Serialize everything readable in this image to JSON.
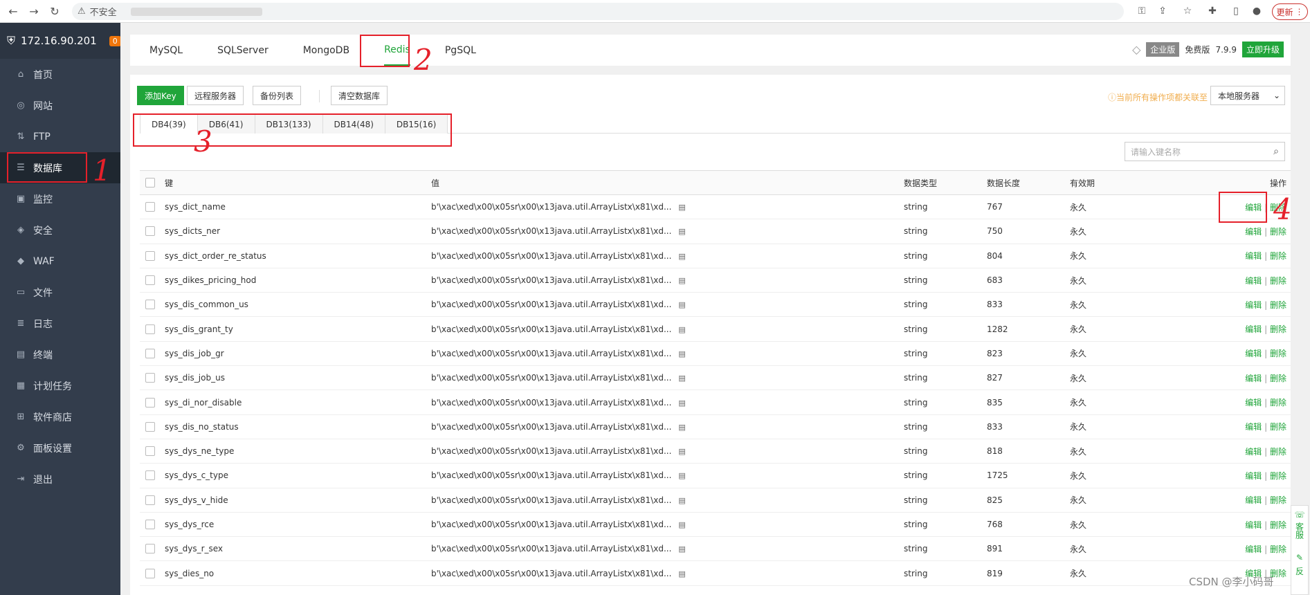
{
  "browser": {
    "insecure_label": "不安全",
    "update_label": "更新"
  },
  "sidebar": {
    "server_ip": "172.16.90.201",
    "badge": "0",
    "items": [
      {
        "label": "首页",
        "icon": "home-icon",
        "glyph": "⌂"
      },
      {
        "label": "网站",
        "icon": "globe-icon",
        "glyph": "◎"
      },
      {
        "label": "FTP",
        "icon": "ftp-icon",
        "glyph": "⇅"
      },
      {
        "label": "数据库",
        "icon": "database-icon",
        "glyph": "☰",
        "active": true
      },
      {
        "label": "监控",
        "icon": "monitor-icon",
        "glyph": "▣"
      },
      {
        "label": "安全",
        "icon": "shield-icon",
        "glyph": "◈"
      },
      {
        "label": "WAF",
        "icon": "waf-icon",
        "glyph": "◆"
      },
      {
        "label": "文件",
        "icon": "folder-icon",
        "glyph": "▭"
      },
      {
        "label": "日志",
        "icon": "log-icon",
        "glyph": "≣"
      },
      {
        "label": "终端",
        "icon": "terminal-icon",
        "glyph": "▤"
      },
      {
        "label": "计划任务",
        "icon": "calendar-icon",
        "glyph": "▦"
      },
      {
        "label": "软件商店",
        "icon": "store-icon",
        "glyph": "⊞"
      },
      {
        "label": "面板设置",
        "icon": "gear-icon",
        "glyph": "⚙"
      },
      {
        "label": "退出",
        "icon": "logout-icon",
        "glyph": "⇥"
      }
    ]
  },
  "tabs": [
    "MySQL",
    "SQLServer",
    "MongoDB",
    "Redis",
    "PgSQL"
  ],
  "active_tab": "Redis",
  "version": {
    "edition": "企业版",
    "free": "免费版",
    "number": "7.9.9",
    "upgrade": "立即升级"
  },
  "toolbar": {
    "add_key": "添加Key",
    "remote_server": "远程服务器",
    "backup_list": "备份列表",
    "clear_db": "清空数据库",
    "warning": "当前所有操作项都关联至",
    "server_select": "本地服务器"
  },
  "db_tabs": [
    "DB4(39)",
    "DB6(41)",
    "DB13(133)",
    "DB14(48)",
    "DB15(16)"
  ],
  "search_placeholder": "请输入键名称",
  "table": {
    "headers": [
      "键",
      "值",
      "数据类型",
      "数据长度",
      "有效期",
      "操作"
    ],
    "edit_label": "编辑",
    "delete_label": "删除",
    "rows": [
      {
        "key": "sys_dict_name",
        "value": "b'\\xac\\xed\\x00\\x05sr\\x00\\x13java.util.ArrayListx\\x81\\xd...",
        "type": "string",
        "length": "767",
        "ttl": "永久"
      },
      {
        "key": "sys_dicts_ner",
        "value": "b'\\xac\\xed\\x00\\x05sr\\x00\\x13java.util.ArrayListx\\x81\\xd...",
        "type": "string",
        "length": "750",
        "ttl": "永久"
      },
      {
        "key": "sys_dict_order_re_status",
        "value": "b'\\xac\\xed\\x00\\x05sr\\x00\\x13java.util.ArrayListx\\x81\\xd...",
        "type": "string",
        "length": "804",
        "ttl": "永久"
      },
      {
        "key": "sys_dikes_pricing_hod",
        "value": "b'\\xac\\xed\\x00\\x05sr\\x00\\x13java.util.ArrayListx\\x81\\xd...",
        "type": "string",
        "length": "683",
        "ttl": "永久"
      },
      {
        "key": "sys_dis_common_us",
        "value": "b'\\xac\\xed\\x00\\x05sr\\x00\\x13java.util.ArrayListx\\x81\\xd...",
        "type": "string",
        "length": "833",
        "ttl": "永久"
      },
      {
        "key": "sys_dis_grant_ty",
        "value": "b'\\xac\\xed\\x00\\x05sr\\x00\\x13java.util.ArrayListx\\x81\\xd...",
        "type": "string",
        "length": "1282",
        "ttl": "永久"
      },
      {
        "key": "sys_dis_job_gr",
        "value": "b'\\xac\\xed\\x00\\x05sr\\x00\\x13java.util.ArrayListx\\x81\\xd...",
        "type": "string",
        "length": "823",
        "ttl": "永久"
      },
      {
        "key": "sys_dis_job_us",
        "value": "b'\\xac\\xed\\x00\\x05sr\\x00\\x13java.util.ArrayListx\\x81\\xd...",
        "type": "string",
        "length": "827",
        "ttl": "永久"
      },
      {
        "key": "sys_di_nor_disable",
        "value": "b'\\xac\\xed\\x00\\x05sr\\x00\\x13java.util.ArrayListx\\x81\\xd...",
        "type": "string",
        "length": "835",
        "ttl": "永久"
      },
      {
        "key": "sys_dis_no_status",
        "value": "b'\\xac\\xed\\x00\\x05sr\\x00\\x13java.util.ArrayListx\\x81\\xd...",
        "type": "string",
        "length": "833",
        "ttl": "永久"
      },
      {
        "key": "sys_dys_ne_type",
        "value": "b'\\xac\\xed\\x00\\x05sr\\x00\\x13java.util.ArrayListx\\x81\\xd...",
        "type": "string",
        "length": "818",
        "ttl": "永久"
      },
      {
        "key": "sys_dys_c_type",
        "value": "b'\\xac\\xed\\x00\\x05sr\\x00\\x13java.util.ArrayListx\\x81\\xd...",
        "type": "string",
        "length": "1725",
        "ttl": "永久"
      },
      {
        "key": "sys_dys_v_hide",
        "value": "b'\\xac\\xed\\x00\\x05sr\\x00\\x13java.util.ArrayListx\\x81\\xd...",
        "type": "string",
        "length": "825",
        "ttl": "永久"
      },
      {
        "key": "sys_dys_rce",
        "value": "b'\\xac\\xed\\x00\\x05sr\\x00\\x13java.util.ArrayListx\\x81\\xd...",
        "type": "string",
        "length": "768",
        "ttl": "永久"
      },
      {
        "key": "sys_dys_r_sex",
        "value": "b'\\xac\\xed\\x00\\x05sr\\x00\\x13java.util.ArrayListx\\x81\\xd...",
        "type": "string",
        "length": "891",
        "ttl": "永久"
      },
      {
        "key": "sys_dies_no",
        "value": "b'\\xac\\xed\\x00\\x05sr\\x00\\x13java.util.ArrayListx\\x81\\xd...",
        "type": "string",
        "length": "819",
        "ttl": "永久"
      }
    ]
  },
  "float": {
    "service": "客服",
    "feedback": "反"
  },
  "watermark": "CSDN @李小码哥",
  "annotations": [
    "1",
    "2",
    "3",
    "4"
  ],
  "annotation_color": "#e5202a",
  "accent_color": "#20a53a"
}
